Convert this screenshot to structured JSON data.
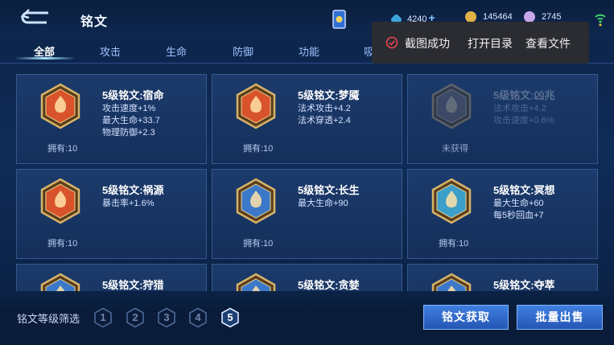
{
  "header": {
    "title": "铭文",
    "resources": [
      {
        "icon": "diamond-icon",
        "value": "4240",
        "plus": "+"
      },
      {
        "icon": "gold-coin-icon",
        "value": "145464"
      },
      {
        "icon": "crystal-icon",
        "value": "2745"
      }
    ]
  },
  "tabs": [
    {
      "label": "全部",
      "active": true
    },
    {
      "label": "攻击"
    },
    {
      "label": "生命"
    },
    {
      "label": "防御"
    },
    {
      "label": "功能"
    },
    {
      "label": "吸"
    }
  ],
  "inscriptions": [
    {
      "name": "5级铭文:宿命",
      "stats": [
        "攻击速度+1%",
        "最大生命+33.7",
        "物理防御+2.3"
      ],
      "owned": "拥有:10",
      "color": "#d8532b",
      "locked": false
    },
    {
      "name": "5级铭文:梦魇",
      "stats": [
        "法术攻击+4.2",
        "法术穿透+2.4"
      ],
      "owned": "拥有:10",
      "color": "#d8532b",
      "locked": false
    },
    {
      "name": "5级铭文:凶兆",
      "stats": [
        "法术攻击+4.2",
        "攻击速度+0.6%"
      ],
      "owned": "未获得",
      "color": "#7c6a6a",
      "locked": true
    },
    {
      "name": "5级铭文:祸源",
      "stats": [
        "暴击率+1.6%"
      ],
      "owned": "拥有:10",
      "color": "#d8532b",
      "locked": false
    },
    {
      "name": "5级铭文:长生",
      "stats": [
        "最大生命+90"
      ],
      "owned": "拥有:10",
      "color": "#3b78c9",
      "locked": false
    },
    {
      "name": "5级铭文:冥想",
      "stats": [
        "最大生命+60",
        "每5秒回血+7"
      ],
      "owned": "拥有:10",
      "color": "#3b9fc9",
      "locked": false
    },
    {
      "name": "5级铭文:狩猎",
      "stats": [],
      "owned": "",
      "color": "#3b78c9",
      "locked": false
    },
    {
      "name": "5级铭文:贪婪",
      "stats": [],
      "owned": "",
      "color": "#3b78c9",
      "locked": false
    },
    {
      "name": "5级铭文:夺萃",
      "stats": [],
      "owned": "",
      "color": "#3b78c9",
      "locked": false
    }
  ],
  "filter": {
    "label": "铭文等级筛选",
    "levels": [
      "1",
      "2",
      "3",
      "4",
      "5"
    ],
    "selected": "5"
  },
  "buttons": {
    "acquire": "铭文获取",
    "sell": "批量出售"
  },
  "toast": {
    "message": "截图成功",
    "open_folder": "打开目录",
    "view_file": "查看文件"
  },
  "colors": {
    "accent": "#2556b4",
    "gold_frame": "#c9a45a",
    "bg": "#0f2c58"
  }
}
